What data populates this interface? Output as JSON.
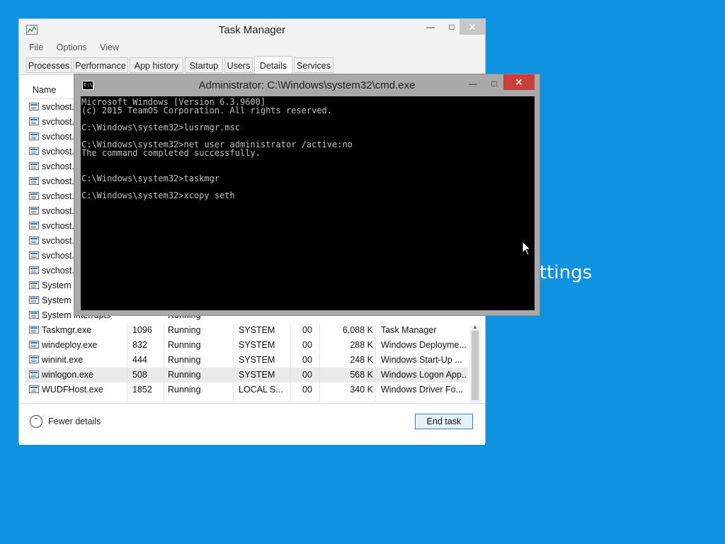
{
  "desktop": {
    "background_color": "#0f93e0",
    "partial_text": "ettings"
  },
  "task_manager": {
    "title": "Task Manager",
    "menu": [
      "File",
      "Options",
      "View"
    ],
    "tabs": [
      "Processes",
      "Performance",
      "App history",
      "Startup",
      "Users",
      "Details",
      "Services"
    ],
    "active_tab": "Details",
    "column_header": "Name",
    "rows": [
      {
        "name": "svchost.e",
        "pid": "",
        "status": "",
        "user": "",
        "cpu": "",
        "mem": "",
        "desc": ""
      },
      {
        "name": "svchost.e",
        "pid": "",
        "status": "",
        "user": "",
        "cpu": "",
        "mem": "",
        "desc": ""
      },
      {
        "name": "svchost.e",
        "pid": "",
        "status": "",
        "user": "",
        "cpu": "",
        "mem": "",
        "desc": ""
      },
      {
        "name": "svchost.e",
        "pid": "",
        "status": "",
        "user": "",
        "cpu": "",
        "mem": "",
        "desc": ""
      },
      {
        "name": "svchost.e",
        "pid": "",
        "status": "",
        "user": "",
        "cpu": "",
        "mem": "",
        "desc": ""
      },
      {
        "name": "svchost.e",
        "pid": "",
        "status": "",
        "user": "",
        "cpu": "",
        "mem": "",
        "desc": ""
      },
      {
        "name": "svchost.e",
        "pid": "",
        "status": "",
        "user": "",
        "cpu": "",
        "mem": "",
        "desc": ""
      },
      {
        "name": "svchost.e",
        "pid": "",
        "status": "",
        "user": "",
        "cpu": "",
        "mem": "",
        "desc": ""
      },
      {
        "name": "svchost.e",
        "pid": "",
        "status": "",
        "user": "",
        "cpu": "",
        "mem": "",
        "desc": ""
      },
      {
        "name": "svchost.e",
        "pid": "",
        "status": "",
        "user": "",
        "cpu": "",
        "mem": "",
        "desc": ""
      },
      {
        "name": "svchost.e",
        "pid": "",
        "status": "",
        "user": "",
        "cpu": "",
        "mem": "",
        "desc": ""
      },
      {
        "name": "svchost.e",
        "pid": "",
        "status": "",
        "user": "",
        "cpu": "",
        "mem": "",
        "desc": ""
      },
      {
        "name": "System",
        "pid": "",
        "status": "",
        "user": "",
        "cpu": "",
        "mem": "",
        "desc": ""
      },
      {
        "name": "System I",
        "pid": "",
        "status": "",
        "user": "",
        "cpu": "",
        "mem": "",
        "desc": ""
      },
      {
        "name": "System interrupts",
        "pid": "",
        "status": "Running",
        "user": "",
        "cpu": "",
        "mem": "",
        "desc": ""
      },
      {
        "name": "Taskmgr.exe",
        "pid": "1096",
        "status": "Running",
        "user": "SYSTEM",
        "cpu": "00",
        "mem": "6,088 K",
        "desc": "Task Manager",
        "icon": "taskmgr"
      },
      {
        "name": "windeploy.exe",
        "pid": "832",
        "status": "Running",
        "user": "SYSTEM",
        "cpu": "00",
        "mem": "288 K",
        "desc": "Windows Deployme..."
      },
      {
        "name": "wininit.exe",
        "pid": "444",
        "status": "Running",
        "user": "SYSTEM",
        "cpu": "00",
        "mem": "248 K",
        "desc": "Windows Start-Up ..."
      },
      {
        "name": "winlogon.exe",
        "pid": "508",
        "status": "Running",
        "user": "SYSTEM",
        "cpu": "00",
        "mem": "568 K",
        "desc": "Windows Logon App...",
        "selected": true
      },
      {
        "name": "WUDFHost.exe",
        "pid": "1852",
        "status": "Running",
        "user": "LOCAL S...",
        "cpu": "00",
        "mem": "340 K",
        "desc": "Windows Driver Fo..."
      }
    ],
    "fewer_details": "Fewer details",
    "end_task": "End task",
    "window_buttons": {
      "minimize": "—",
      "maximize": "□",
      "close": "✕"
    }
  },
  "cmd": {
    "title": "Administrator: C:\\Windows\\system32\\cmd.exe",
    "icon_text": "C:\\",
    "lines": [
      "Microsoft Windows [Version 6.3.9600]",
      "(c) 2015 TeamOS Corporation. All rights reserved.",
      "",
      "C:\\Windows\\system32>lusrmgr.msc",
      "",
      "C:\\Windows\\system32>net user administrator /active:no",
      "The command completed successfully.",
      "",
      "",
      "C:\\Windows\\system32>taskmgr",
      "",
      "C:\\Windows\\system32>xcopy seth"
    ],
    "window_buttons": {
      "minimize": "—",
      "maximize": "□",
      "close": "✕"
    },
    "close_color": "#c9403a"
  }
}
